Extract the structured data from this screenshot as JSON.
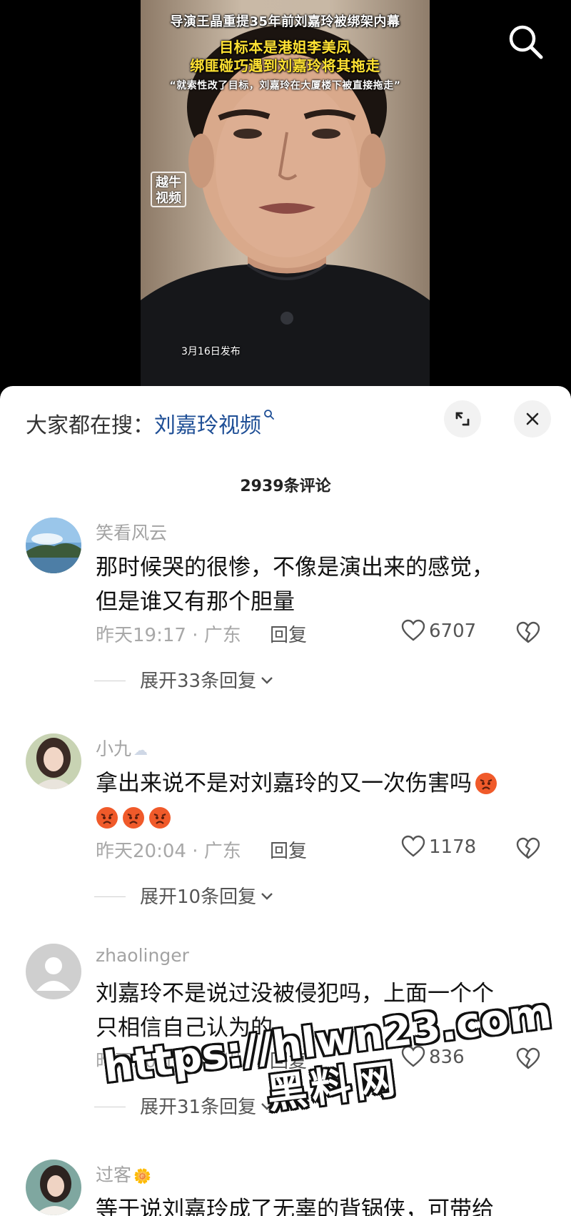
{
  "video": {
    "caption_line1": "导演王晶重提35年前刘嘉玲被绑架内幕",
    "caption_line2": "目标本是港姐李美凤",
    "caption_line3": "绑匪碰巧遇到刘嘉玲将其拖走",
    "caption_quote": "“就索性改了目标，刘嘉玲在大厦楼下被直接拖走”",
    "channel_badge": "越牛\n视频",
    "publish_date": "3月16日发布",
    "icons": {
      "search": "search-icon"
    }
  },
  "sheet": {
    "search_prefix": "大家都在搜：",
    "search_keyword": "刘嘉玲视频",
    "comment_count": "2939条评论",
    "icons": {
      "expand": "expand-icon",
      "close": "close-icon"
    }
  },
  "comments": [
    {
      "user": "笑看风云",
      "lines": [
        "那时候哭的很惨，不像是演出来的感觉，",
        "但是谁又有那个胆量"
      ],
      "time_location": "昨天19:17 · 广东",
      "reply_label": "回复",
      "likes": "6707",
      "expand_label": "展开33条回复"
    },
    {
      "user": "小九",
      "user_deco": "☁",
      "lines": [
        "拿出来说不是对刘嘉玲的又一次伤害吗"
      ],
      "emoji": "angry-face",
      "time_location": "昨天20:04 · 广东",
      "reply_label": "回复",
      "likes": "1178",
      "expand_label": "展开10条回复"
    },
    {
      "user": "zhaolinger",
      "lines": [
        "刘嘉玲不是说过没被侵犯吗，上面一个个",
        "只相信自己认为的。"
      ],
      "time_location": "昨天20:13 · 四川",
      "reply_label": "回复",
      "likes": "836",
      "expand_label": "展开31条回复"
    },
    {
      "user": "过客",
      "user_deco": "🌼",
      "lines": [
        "等于说刘嘉玲成了无辜的背锅侠，可带给"
      ]
    }
  ],
  "watermark": {
    "line1": "https://hlwn23.com",
    "line2": "黑料网"
  },
  "colors": {
    "link_blue": "#1f4f96",
    "meta_gray": "#a8a8a8",
    "caption_yellow": "#ffe233"
  }
}
